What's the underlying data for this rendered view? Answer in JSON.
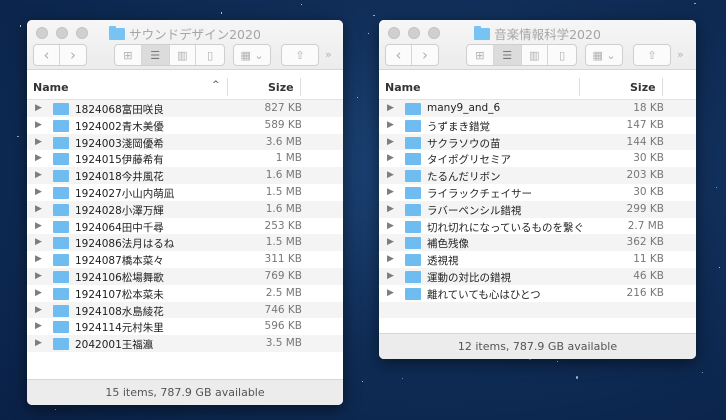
{
  "windows": [
    {
      "title": "サウンドデザイン2020",
      "header": {
        "name": "Name",
        "size": "Size"
      },
      "status": "15 items, 787.9 GB available",
      "items": [
        {
          "name": "1824068富田咲良",
          "size": "827 KB"
        },
        {
          "name": "1924002青木美優",
          "size": "589 KB"
        },
        {
          "name": "1924003淺岡優希",
          "size": "3.6 MB"
        },
        {
          "name": "1924015伊藤希有",
          "size": "1 MB"
        },
        {
          "name": "1924018今井風花",
          "size": "1.6 MB"
        },
        {
          "name": "1924027小山内萌凪",
          "size": "1.5 MB"
        },
        {
          "name": "1924028小澤万輝",
          "size": "1.6 MB"
        },
        {
          "name": "1924064田中千尋",
          "size": "253 KB"
        },
        {
          "name": "1924086法月はるね",
          "size": "1.5 MB"
        },
        {
          "name": "1924087橋本菜々",
          "size": "311 KB"
        },
        {
          "name": "1924106松場舞歌",
          "size": "769 KB"
        },
        {
          "name": "1924107松本菜未",
          "size": "2.5 MB"
        },
        {
          "name": "1924108水島綾花",
          "size": "746 KB"
        },
        {
          "name": "1924114元村朱里",
          "size": "596 KB"
        },
        {
          "name": "2042001王福瀛",
          "size": "3.5 MB"
        }
      ]
    },
    {
      "title": "音楽情報科学2020",
      "header": {
        "name": "Name",
        "size": "Size"
      },
      "status": "12 items, 787.9 GB available",
      "items": [
        {
          "name": "many9_and_6",
          "size": "18 KB"
        },
        {
          "name": "うずまき錯覚",
          "size": "147 KB"
        },
        {
          "name": "サクラソウの苗",
          "size": "144 KB"
        },
        {
          "name": "タイポグリセミア",
          "size": "30 KB"
        },
        {
          "name": "たるんだリボン",
          "size": "203 KB"
        },
        {
          "name": "ライラックチェイサー",
          "size": "30 KB"
        },
        {
          "name": "ラバーペンシル錯視",
          "size": "299 KB"
        },
        {
          "name": "切れ切れになっているものを繋ぐ",
          "size": "2.7 MB"
        },
        {
          "name": "補色残像",
          "size": "362 KB"
        },
        {
          "name": "透視視",
          "size": "11 KB"
        },
        {
          "name": "運動の対比の錯視",
          "size": "46 KB"
        },
        {
          "name": "離れていても心はひとつ",
          "size": "216 KB"
        }
      ]
    }
  ],
  "toolbar": {
    "more": "»"
  }
}
